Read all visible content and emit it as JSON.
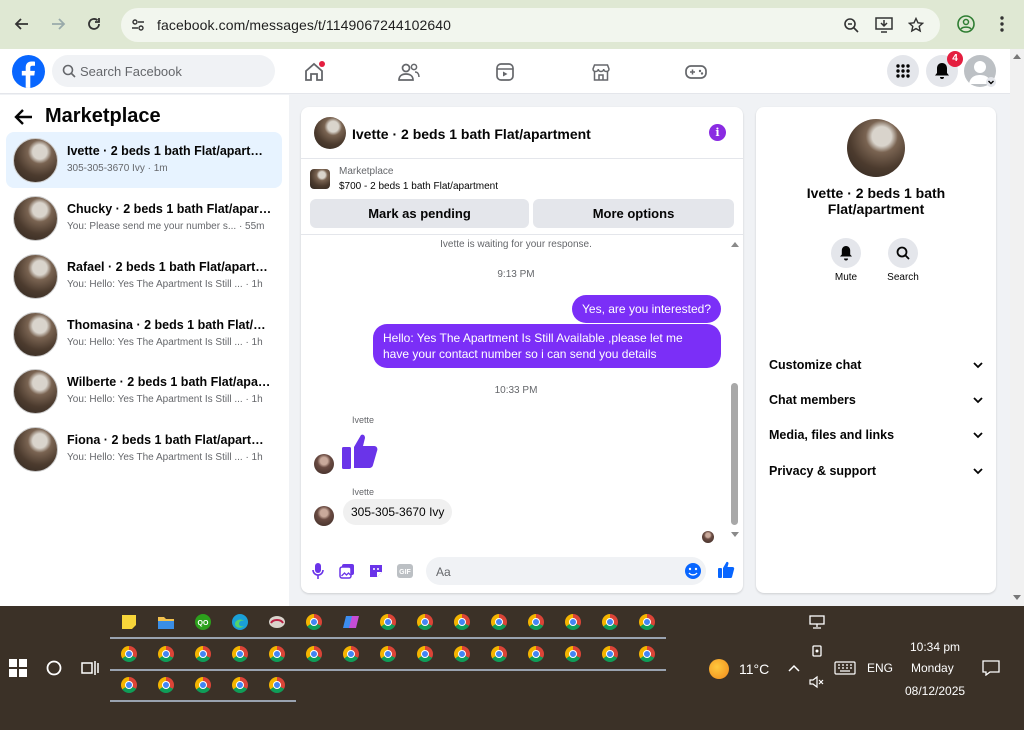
{
  "browser": {
    "url": "facebook.com/messages/t/1149067244102640"
  },
  "header": {
    "search_placeholder": "Search Facebook",
    "notification_count": "4"
  },
  "sidebar": {
    "title": "Marketplace",
    "conversations": [
      {
        "name": "Ivette · 2 beds 1 bath Flat/apartment",
        "preview": "305-305-3670 Ivy · 1m",
        "active": true
      },
      {
        "name": "Chucky · 2 beds 1 bath Flat/apartm...",
        "preview": "You: Please send me your number s... · 55m"
      },
      {
        "name": "Rafael · 2 beds 1 bath Flat/apartm...",
        "preview": "You: Hello: Yes The Apartment Is Still ... · 1h"
      },
      {
        "name": "Thomasina · 2 beds 1 bath Flat/apa...",
        "preview": "You: Hello: Yes The Apartment Is Still ... · 1h"
      },
      {
        "name": "Wilberte · 2 beds 1 bath Flat/apart...",
        "preview": "You: Hello: Yes The Apartment Is Still ... · 1h"
      },
      {
        "name": "Fiona · 2 beds 1 bath Flat/apartment",
        "preview": "You: Hello: Yes The Apartment Is Still ... · 1h"
      }
    ]
  },
  "chat": {
    "title": "Ivette · 2 beds 1 bath Flat/apartment",
    "marketplace_label": "Marketplace",
    "listing": "$700 - 2 beds 1 bath Flat/apartment",
    "btn_pending": "Mark as pending",
    "btn_more": "More options",
    "waiting": "Ivette is waiting for your response.",
    "time1": "9:13 PM",
    "msg_out1": "Yes, are you interested?",
    "msg_out2": "Hello: Yes The Apartment Is Still Available ,please let me have your contact number so i can send you details",
    "time2": "10:33 PM",
    "sender1": "Ivette",
    "sender2": "Ivette",
    "msg_in": "305-305-3670 Ivy",
    "composer_placeholder": "Aa"
  },
  "info": {
    "title": "Ivette · 2 beds 1 bath Flat/apartment",
    "mute": "Mute",
    "search": "Search",
    "rows": [
      "Customize chat",
      "Chat members",
      "Media, files and links",
      "Privacy & support"
    ]
  },
  "taskbar": {
    "temperature": "11°C",
    "language": "ENG",
    "time": "10:34 pm",
    "day": "Monday",
    "date": "08/12/2025"
  },
  "colors": {
    "brand": "#0866ff",
    "bubble_out": "#7b2ff7",
    "accent_purple": "#8a2be2"
  }
}
